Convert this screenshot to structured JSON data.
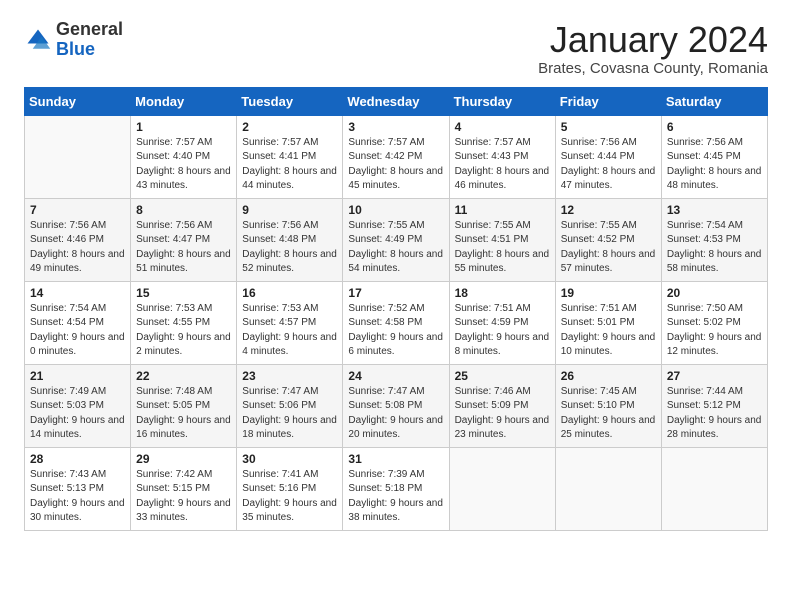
{
  "logo": {
    "general": "General",
    "blue": "Blue"
  },
  "header": {
    "month_title": "January 2024",
    "subtitle": "Brates, Covasna County, Romania"
  },
  "days_of_week": [
    "Sunday",
    "Monday",
    "Tuesday",
    "Wednesday",
    "Thursday",
    "Friday",
    "Saturday"
  ],
  "weeks": [
    [
      {
        "day": "",
        "sunrise": "",
        "sunset": "",
        "daylight": ""
      },
      {
        "day": "1",
        "sunrise": "Sunrise: 7:57 AM",
        "sunset": "Sunset: 4:40 PM",
        "daylight": "Daylight: 8 hours and 43 minutes."
      },
      {
        "day": "2",
        "sunrise": "Sunrise: 7:57 AM",
        "sunset": "Sunset: 4:41 PM",
        "daylight": "Daylight: 8 hours and 44 minutes."
      },
      {
        "day": "3",
        "sunrise": "Sunrise: 7:57 AM",
        "sunset": "Sunset: 4:42 PM",
        "daylight": "Daylight: 8 hours and 45 minutes."
      },
      {
        "day": "4",
        "sunrise": "Sunrise: 7:57 AM",
        "sunset": "Sunset: 4:43 PM",
        "daylight": "Daylight: 8 hours and 46 minutes."
      },
      {
        "day": "5",
        "sunrise": "Sunrise: 7:56 AM",
        "sunset": "Sunset: 4:44 PM",
        "daylight": "Daylight: 8 hours and 47 minutes."
      },
      {
        "day": "6",
        "sunrise": "Sunrise: 7:56 AM",
        "sunset": "Sunset: 4:45 PM",
        "daylight": "Daylight: 8 hours and 48 minutes."
      }
    ],
    [
      {
        "day": "7",
        "sunrise": "Sunrise: 7:56 AM",
        "sunset": "Sunset: 4:46 PM",
        "daylight": "Daylight: 8 hours and 49 minutes."
      },
      {
        "day": "8",
        "sunrise": "Sunrise: 7:56 AM",
        "sunset": "Sunset: 4:47 PM",
        "daylight": "Daylight: 8 hours and 51 minutes."
      },
      {
        "day": "9",
        "sunrise": "Sunrise: 7:56 AM",
        "sunset": "Sunset: 4:48 PM",
        "daylight": "Daylight: 8 hours and 52 minutes."
      },
      {
        "day": "10",
        "sunrise": "Sunrise: 7:55 AM",
        "sunset": "Sunset: 4:49 PM",
        "daylight": "Daylight: 8 hours and 54 minutes."
      },
      {
        "day": "11",
        "sunrise": "Sunrise: 7:55 AM",
        "sunset": "Sunset: 4:51 PM",
        "daylight": "Daylight: 8 hours and 55 minutes."
      },
      {
        "day": "12",
        "sunrise": "Sunrise: 7:55 AM",
        "sunset": "Sunset: 4:52 PM",
        "daylight": "Daylight: 8 hours and 57 minutes."
      },
      {
        "day": "13",
        "sunrise": "Sunrise: 7:54 AM",
        "sunset": "Sunset: 4:53 PM",
        "daylight": "Daylight: 8 hours and 58 minutes."
      }
    ],
    [
      {
        "day": "14",
        "sunrise": "Sunrise: 7:54 AM",
        "sunset": "Sunset: 4:54 PM",
        "daylight": "Daylight: 9 hours and 0 minutes."
      },
      {
        "day": "15",
        "sunrise": "Sunrise: 7:53 AM",
        "sunset": "Sunset: 4:55 PM",
        "daylight": "Daylight: 9 hours and 2 minutes."
      },
      {
        "day": "16",
        "sunrise": "Sunrise: 7:53 AM",
        "sunset": "Sunset: 4:57 PM",
        "daylight": "Daylight: 9 hours and 4 minutes."
      },
      {
        "day": "17",
        "sunrise": "Sunrise: 7:52 AM",
        "sunset": "Sunset: 4:58 PM",
        "daylight": "Daylight: 9 hours and 6 minutes."
      },
      {
        "day": "18",
        "sunrise": "Sunrise: 7:51 AM",
        "sunset": "Sunset: 4:59 PM",
        "daylight": "Daylight: 9 hours and 8 minutes."
      },
      {
        "day": "19",
        "sunrise": "Sunrise: 7:51 AM",
        "sunset": "Sunset: 5:01 PM",
        "daylight": "Daylight: 9 hours and 10 minutes."
      },
      {
        "day": "20",
        "sunrise": "Sunrise: 7:50 AM",
        "sunset": "Sunset: 5:02 PM",
        "daylight": "Daylight: 9 hours and 12 minutes."
      }
    ],
    [
      {
        "day": "21",
        "sunrise": "Sunrise: 7:49 AM",
        "sunset": "Sunset: 5:03 PM",
        "daylight": "Daylight: 9 hours and 14 minutes."
      },
      {
        "day": "22",
        "sunrise": "Sunrise: 7:48 AM",
        "sunset": "Sunset: 5:05 PM",
        "daylight": "Daylight: 9 hours and 16 minutes."
      },
      {
        "day": "23",
        "sunrise": "Sunrise: 7:47 AM",
        "sunset": "Sunset: 5:06 PM",
        "daylight": "Daylight: 9 hours and 18 minutes."
      },
      {
        "day": "24",
        "sunrise": "Sunrise: 7:47 AM",
        "sunset": "Sunset: 5:08 PM",
        "daylight": "Daylight: 9 hours and 20 minutes."
      },
      {
        "day": "25",
        "sunrise": "Sunrise: 7:46 AM",
        "sunset": "Sunset: 5:09 PM",
        "daylight": "Daylight: 9 hours and 23 minutes."
      },
      {
        "day": "26",
        "sunrise": "Sunrise: 7:45 AM",
        "sunset": "Sunset: 5:10 PM",
        "daylight": "Daylight: 9 hours and 25 minutes."
      },
      {
        "day": "27",
        "sunrise": "Sunrise: 7:44 AM",
        "sunset": "Sunset: 5:12 PM",
        "daylight": "Daylight: 9 hours and 28 minutes."
      }
    ],
    [
      {
        "day": "28",
        "sunrise": "Sunrise: 7:43 AM",
        "sunset": "Sunset: 5:13 PM",
        "daylight": "Daylight: 9 hours and 30 minutes."
      },
      {
        "day": "29",
        "sunrise": "Sunrise: 7:42 AM",
        "sunset": "Sunset: 5:15 PM",
        "daylight": "Daylight: 9 hours and 33 minutes."
      },
      {
        "day": "30",
        "sunrise": "Sunrise: 7:41 AM",
        "sunset": "Sunset: 5:16 PM",
        "daylight": "Daylight: 9 hours and 35 minutes."
      },
      {
        "day": "31",
        "sunrise": "Sunrise: 7:39 AM",
        "sunset": "Sunset: 5:18 PM",
        "daylight": "Daylight: 9 hours and 38 minutes."
      },
      {
        "day": "",
        "sunrise": "",
        "sunset": "",
        "daylight": ""
      },
      {
        "day": "",
        "sunrise": "",
        "sunset": "",
        "daylight": ""
      },
      {
        "day": "",
        "sunrise": "",
        "sunset": "",
        "daylight": ""
      }
    ]
  ]
}
